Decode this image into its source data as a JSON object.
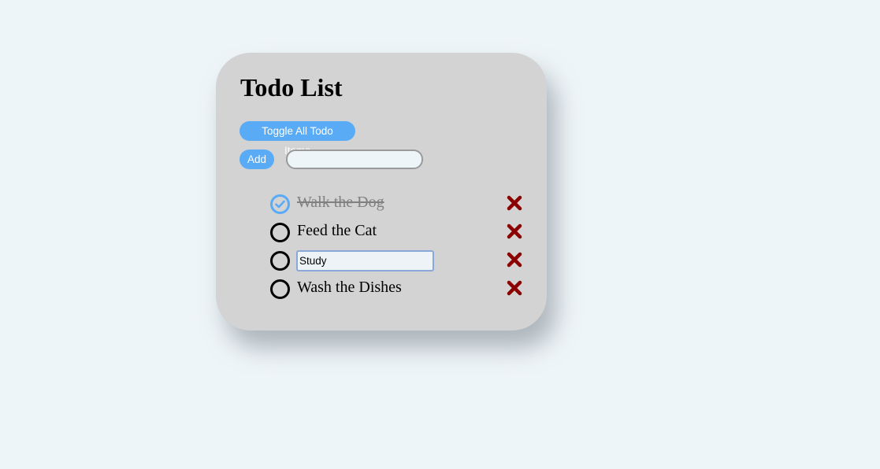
{
  "title": "Todo List",
  "toggle_label": "Toggle All Todo Items",
  "add_label": "Add",
  "add_input_value": "",
  "colors": {
    "accent": "#5aabf6",
    "delete": "#8b0000",
    "card": "#d3d3d3",
    "background": "#eef5f8"
  },
  "todos": [
    {
      "text": "Walk the Dog",
      "completed": true,
      "editing": false,
      "check_icon": "check-circle-icon",
      "delete_icon": "x-icon"
    },
    {
      "text": "Feed the Cat",
      "completed": false,
      "editing": false,
      "check_icon": "circle-icon",
      "delete_icon": "x-icon"
    },
    {
      "text": "Study",
      "completed": false,
      "editing": true,
      "check_icon": "circle-icon",
      "delete_icon": "x-icon"
    },
    {
      "text": "Wash the Dishes",
      "completed": false,
      "editing": false,
      "check_icon": "circle-icon",
      "delete_icon": "x-icon"
    }
  ]
}
